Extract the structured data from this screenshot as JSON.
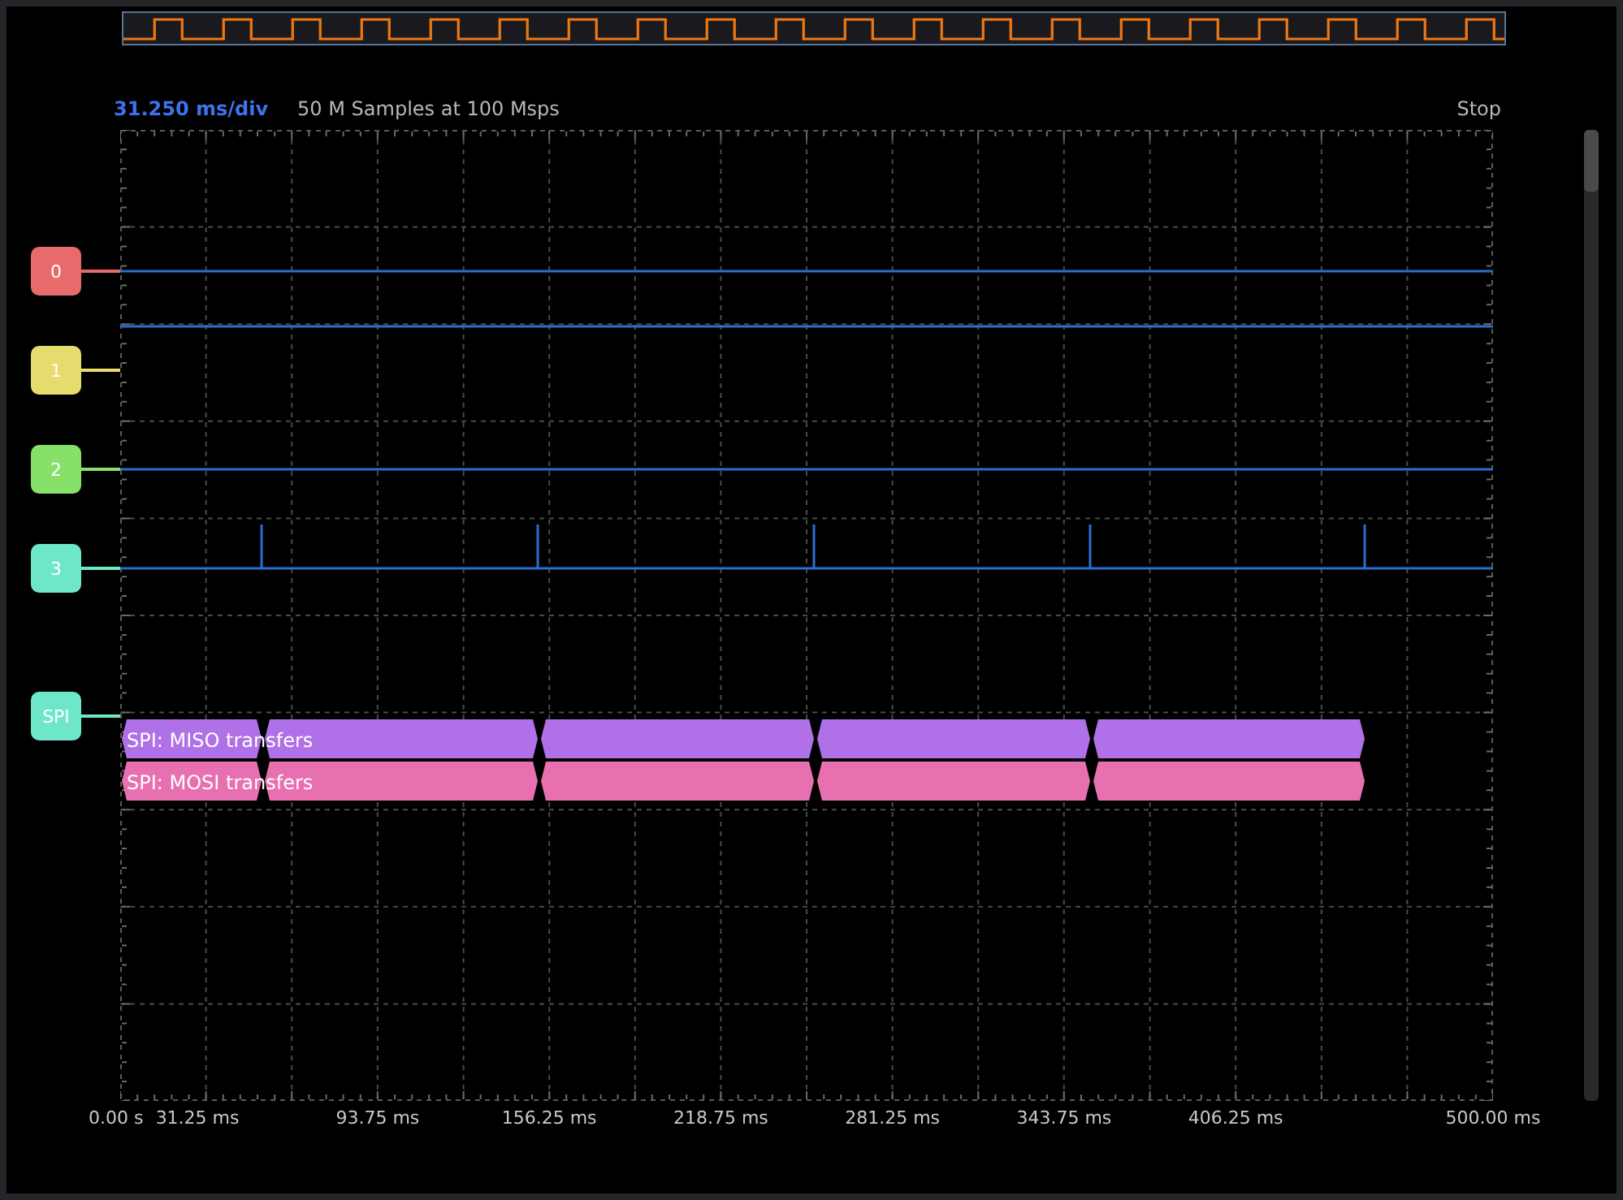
{
  "header": {
    "timebase": "31.250 ms/div",
    "samples": "50 M Samples at 100 Msps",
    "status": "Stop"
  },
  "channels": [
    {
      "name": "0",
      "kind": "digital",
      "color": "#e86a6a"
    },
    {
      "name": "1",
      "kind": "digital",
      "color": "#e6dc6e"
    },
    {
      "name": "2",
      "kind": "digital",
      "color": "#86e06a"
    },
    {
      "name": "3",
      "kind": "digital",
      "color": "#6ee6c8"
    },
    {
      "name": "SPI",
      "kind": "bus",
      "color": "#6ee6c8"
    }
  ],
  "bus_rows": [
    {
      "label": "SPI: MISO transfers",
      "color": "#b070e8"
    },
    {
      "label": "SPI: MOSI transfers",
      "color": "#e870b0"
    }
  ],
  "time_axis": [
    "0.00 s",
    "31.25 ms",
    "93.75 ms",
    "156.25 ms",
    "218.75 ms",
    "281.25 ms",
    "343.75 ms",
    "406.25 ms",
    "500.00 ms"
  ]
}
